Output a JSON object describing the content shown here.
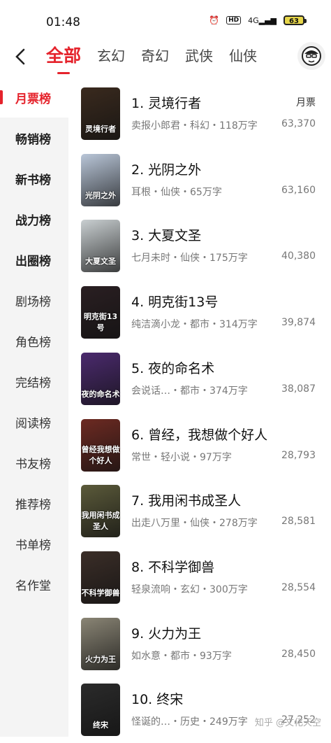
{
  "status_bar": {
    "time": "01:48",
    "network": "4G",
    "battery": "63"
  },
  "top_tabs": [
    {
      "label": "全部",
      "active": true
    },
    {
      "label": "玄幻",
      "active": false
    },
    {
      "label": "奇幻",
      "active": false
    },
    {
      "label": "武侠",
      "active": false
    },
    {
      "label": "仙侠",
      "active": false
    }
  ],
  "sidebar": [
    {
      "label": "月票榜",
      "active": true,
      "bold": true
    },
    {
      "label": "畅销榜",
      "active": false,
      "bold": true
    },
    {
      "label": "新书榜",
      "active": false,
      "bold": true
    },
    {
      "label": "战力榜",
      "active": false,
      "bold": true
    },
    {
      "label": "出圈榜",
      "active": false,
      "bold": true
    },
    {
      "label": "剧场榜",
      "active": false,
      "bold": false
    },
    {
      "label": "角色榜",
      "active": false,
      "bold": false
    },
    {
      "label": "完结榜",
      "active": false,
      "bold": false
    },
    {
      "label": "阅读榜",
      "active": false,
      "bold": false
    },
    {
      "label": "书友榜",
      "active": false,
      "bold": false
    },
    {
      "label": "推荐榜",
      "active": false,
      "bold": false
    },
    {
      "label": "书单榜",
      "active": false,
      "bold": false
    },
    {
      "label": "名作堂",
      "active": false,
      "bold": false
    }
  ],
  "list": {
    "column_header": "月票",
    "books": [
      {
        "title": "1. 灵境行者",
        "meta": "卖报小郎君・科幻・118万字",
        "votes": "63,370",
        "cover_text": "灵境行者",
        "cover_color": "#3a2a1e"
      },
      {
        "title": "2. 光阴之外",
        "meta": "耳根・仙侠・65万字",
        "votes": "63,160",
        "cover_text": "光阴之外",
        "cover_color": "#b9c6d8"
      },
      {
        "title": "3. 大夏文圣",
        "meta": "七月未时・仙侠・175万字",
        "votes": "40,380",
        "cover_text": "大夏文圣",
        "cover_color": "#c9cfd1"
      },
      {
        "title": "4. 明克街13号",
        "meta": "纯洁滴小龙・都市・314万字",
        "votes": "39,874",
        "cover_text": "明克街13号",
        "cover_color": "#2a1f22"
      },
      {
        "title": "5. 夜的命名术",
        "meta": "会说话…・都市・374万字",
        "votes": "38,087",
        "cover_text": "夜的命名术",
        "cover_color": "#4b2a6e"
      },
      {
        "title": "6. 曾经，我想做个好人",
        "meta": "常世・轻小说・97万字",
        "votes": "28,793",
        "cover_text": "曾经我想做个好人",
        "cover_color": "#6d2a22"
      },
      {
        "title": "7. 我用闲书成圣人",
        "meta": "出走八万里・仙侠・278万字",
        "votes": "28,581",
        "cover_text": "我用闲书成圣人",
        "cover_color": "#5b5a3a"
      },
      {
        "title": "8. 不科学御兽",
        "meta": "轻泉流响・玄幻・300万字",
        "votes": "28,554",
        "cover_text": "不科学御兽",
        "cover_color": "#3b2e28"
      },
      {
        "title": "9. 火力为王",
        "meta": "如水意・都市・93万字",
        "votes": "28,450",
        "cover_text": "火力为王",
        "cover_color": "#8a8575"
      },
      {
        "title": "10. 终宋",
        "meta": "怪诞的…・历史・249万字",
        "votes": "27,252",
        "cover_text": "终宋",
        "cover_color": "#2b2b2b"
      }
    ]
  },
  "watermark": "知乎 @文化天空",
  "accent_color": "#e5232c"
}
